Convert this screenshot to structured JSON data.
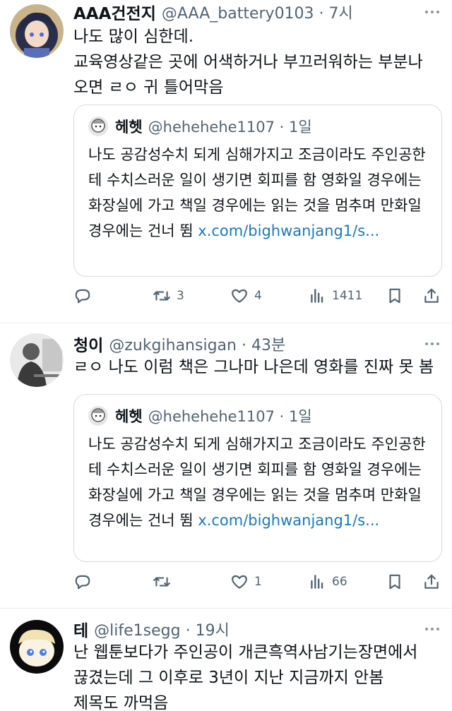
{
  "tweets": [
    {
      "name": "AAA건전지",
      "handle_time": "@AAA_battery0103 · 7시",
      "text": "나도 많이 심한데.\n교육영상같은 곳에 어색하거나 부끄러워하는 부분나\n오면 ㄹㅇ 귀 틀어막음",
      "quote": {
        "name": "헤헷",
        "handle_time": "@hehehehe1107 · 1일",
        "text": "나도 공감성수치 되게 심해가지고 조금이라도 주인공한테 수치스러운 일이 생기면 회피를 함 영화일 경우에는 화장실에 가고 책일 경우에는 읽는 것을 멈추며 만화일 경우에는 건너 뜀 ",
        "link": "x.com/bighwanjang1/s..."
      },
      "reply_count": "",
      "retweet_count": "3",
      "like_count": "4",
      "view_count": "1411"
    },
    {
      "name": "청이",
      "handle_time": "@zukgihansigan · 43분",
      "text": "ㄹㅇ 나도 이럼 책은 그나마 나은데 영화를 진짜 못 봄",
      "quote": {
        "name": "헤헷",
        "handle_time": "@hehehehe1107 · 1일",
        "text": "나도 공감성수치 되게 심해가지고 조금이라도 주인공한테 수치스러운 일이 생기면 회피를 함 영화일 경우에는 화장실에 가고 책일 경우에는 읽는 것을 멈추며 만화일 경우에는 건너 뜀 ",
        "link": "x.com/bighwanjang1/s..."
      },
      "reply_count": "",
      "retweet_count": "",
      "like_count": "1",
      "view_count": "66"
    },
    {
      "name": "테",
      "handle_time": "@life1segg · 19시",
      "text": "난 웹툰보다가 주인공이 개큰흑역사남기는장면에서\n끊겼는데 그 이후로 3년이 지난 지금까지 안봄\n제목도 까먹음"
    }
  ],
  "icons": [
    "reply-icon",
    "retweet-icon",
    "like-icon",
    "views-icon",
    "bookmark-icon",
    "share-icon",
    "more-icon"
  ],
  "colors": {
    "text": "#0f1419",
    "secondary": "#536471",
    "link": "#1d78b8",
    "border": "#d6dbe0"
  }
}
